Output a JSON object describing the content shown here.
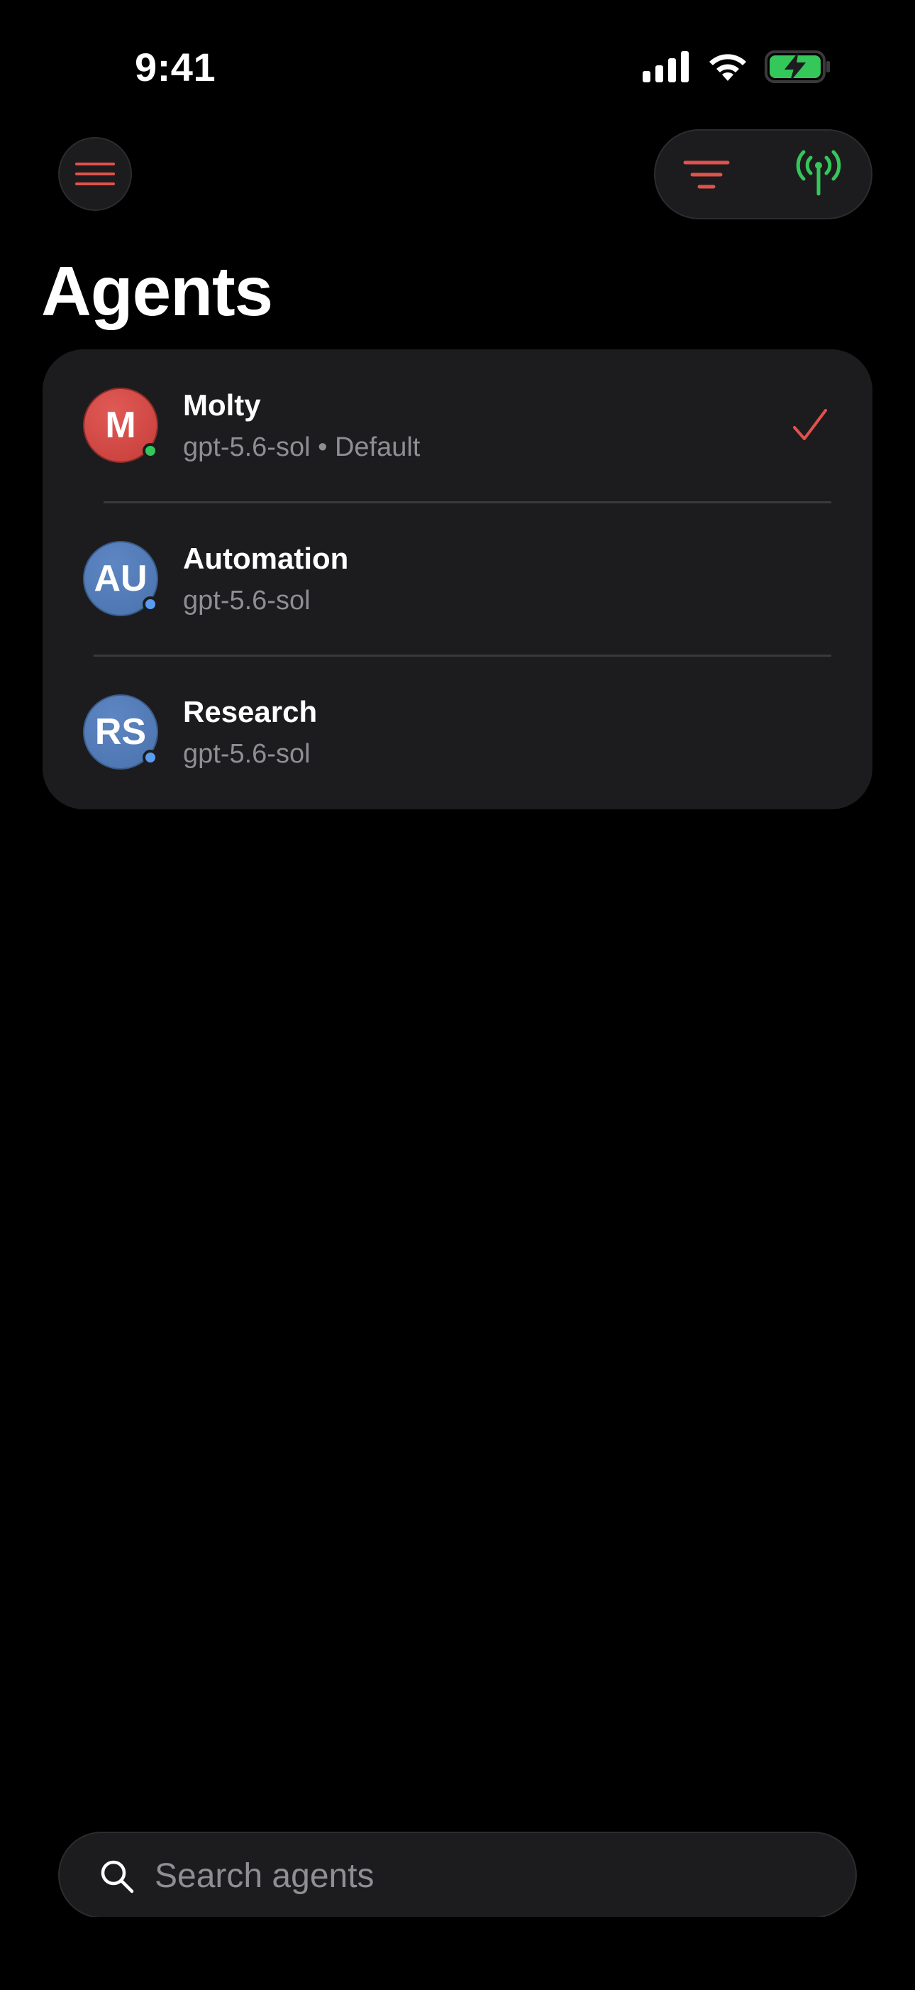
{
  "status_bar": {
    "time": "9:41",
    "icons": [
      "signal-icon",
      "wifi-icon",
      "battery-charging-icon"
    ],
    "battery_color": "#34c759"
  },
  "header": {
    "menu_icon": "hamburger-icon",
    "filter_icon": "filter-icon",
    "antenna_icon": "antenna-icon",
    "title": "Agents"
  },
  "agents": [
    {
      "initials": "M",
      "name": "Molty",
      "subtitle": "gpt-5.6-sol • Default",
      "avatar_color": "#d14b47",
      "status_color": "#34c759",
      "selected": true
    },
    {
      "initials": "AU",
      "name": "Automation",
      "subtitle": "gpt-5.6-sol",
      "avatar_color": "#527cb8",
      "status_color": "#5a9cf0",
      "selected": false
    },
    {
      "initials": "RS",
      "name": "Research",
      "subtitle": "gpt-5.6-sol",
      "avatar_color": "#527cb8",
      "status_color": "#5a9cf0",
      "selected": false
    }
  ],
  "search": {
    "placeholder": "Search agents",
    "value": ""
  },
  "colors": {
    "accent_red": "#e0524c",
    "accent_green": "#34c759",
    "card_bg": "#1c1c1e",
    "secondary_text": "#8e8e93"
  }
}
